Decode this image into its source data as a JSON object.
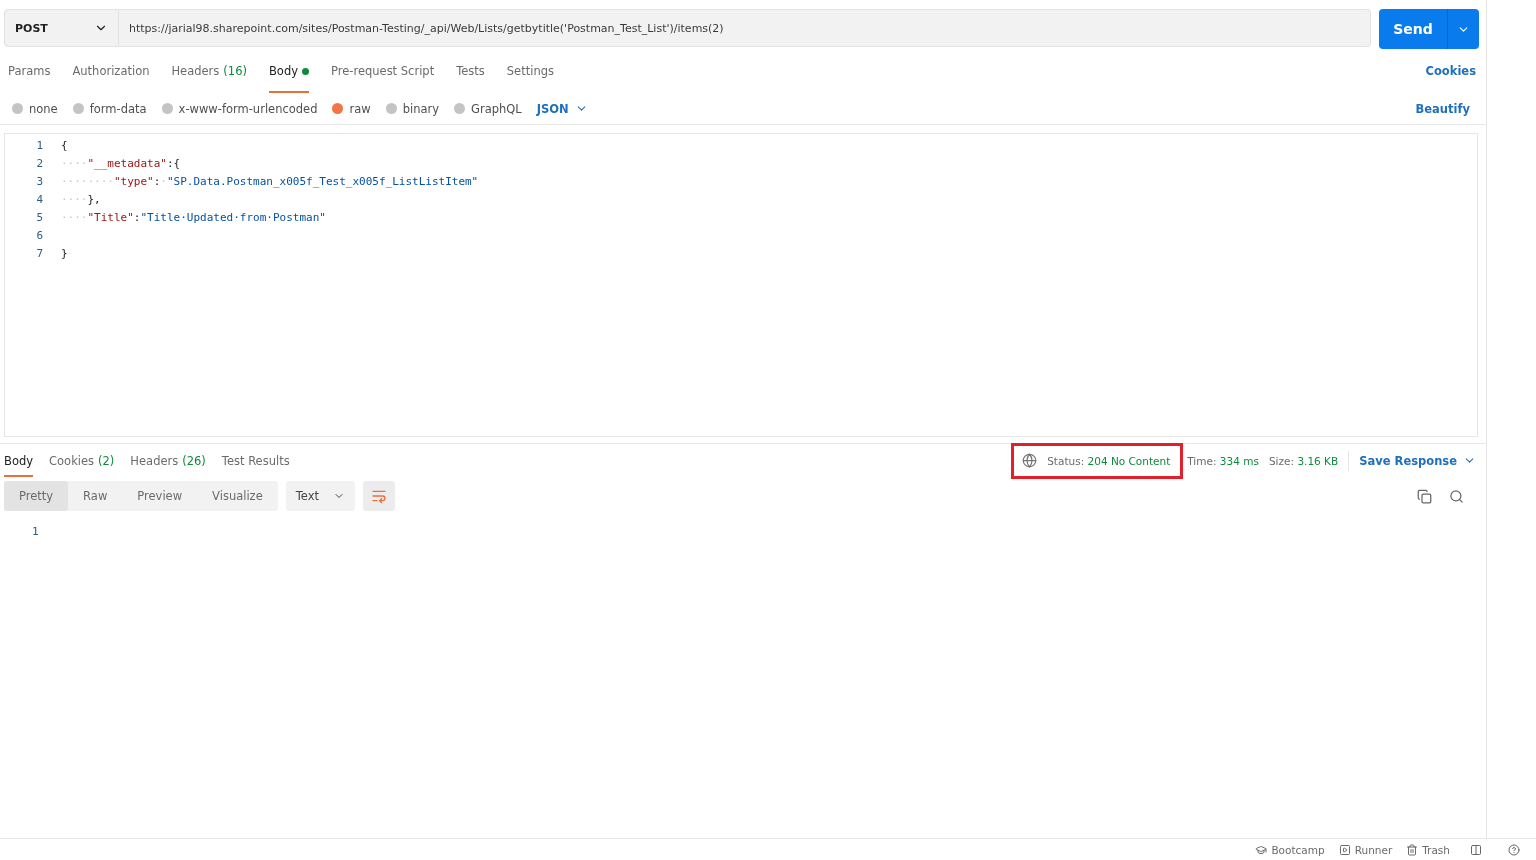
{
  "request": {
    "method": "POST",
    "url": "https://jarial98.sharepoint.com/sites/Postman-Testing/_api/Web/Lists/getbytitle('Postman_Test_List')/items(2)",
    "send": "Send"
  },
  "request_tabs": [
    {
      "label": "Params",
      "selected": false
    },
    {
      "label": "Authorization",
      "selected": false
    },
    {
      "label": "Headers",
      "count": "(16)",
      "selected": false
    },
    {
      "label": "Body",
      "dot": true,
      "selected": true
    },
    {
      "label": "Pre-request Script",
      "selected": false
    },
    {
      "label": "Tests",
      "selected": false
    },
    {
      "label": "Settings",
      "selected": false
    }
  ],
  "cookies_link": "Cookies",
  "body_types": [
    {
      "label": "none",
      "selected": false
    },
    {
      "label": "form-data",
      "selected": false
    },
    {
      "label": "x-www-form-urlencoded",
      "selected": false
    },
    {
      "label": "raw",
      "selected": true
    },
    {
      "label": "binary",
      "selected": false
    },
    {
      "label": "GraphQL",
      "selected": false
    }
  ],
  "language": "JSON",
  "beautify": "Beautify",
  "editor_lines": [
    {
      "number": "1",
      "tokens": [
        {
          "kind": "punct",
          "text": "{"
        }
      ]
    },
    {
      "number": "2",
      "tokens": [
        {
          "kind": "ws",
          "text": "····"
        },
        {
          "kind": "key",
          "text": "\"__metadata\""
        },
        {
          "kind": "punct",
          "text": ":{"
        }
      ]
    },
    {
      "number": "3",
      "tokens": [
        {
          "kind": "ws",
          "text": "········"
        },
        {
          "kind": "key",
          "text": "\"type\""
        },
        {
          "kind": "punct",
          "text": ":"
        },
        {
          "kind": "ws",
          "text": "·"
        },
        {
          "kind": "str",
          "text": "\"SP.Data.Postman_x005f_Test_x005f_ListListItem\""
        }
      ]
    },
    {
      "number": "4",
      "tokens": [
        {
          "kind": "ws",
          "text": "····"
        },
        {
          "kind": "punct",
          "text": "},"
        }
      ]
    },
    {
      "number": "5",
      "tokens": [
        {
          "kind": "ws",
          "text": "····"
        },
        {
          "kind": "key",
          "text": "\"Title\""
        },
        {
          "kind": "punct",
          "text": ":"
        },
        {
          "kind": "str",
          "text": "\"Title·Updated·from·Postman\""
        }
      ]
    },
    {
      "number": "6"
    },
    {
      "number": "7",
      "tokens": [
        {
          "kind": "punct",
          "text": "}"
        }
      ]
    }
  ],
  "response_tabs": [
    {
      "label": "Body",
      "selected": true
    },
    {
      "label": "Cookies",
      "count": "(2)",
      "selected": false
    },
    {
      "label": "Headers",
      "count": "(26)",
      "selected": false
    },
    {
      "label": "Test Results",
      "selected": false
    }
  ],
  "response_meta": [
    {
      "label": "Status:",
      "value": "204 No Content"
    },
    {
      "label": "Time:",
      "value": "334 ms"
    },
    {
      "label": "Size:",
      "value": "3.16 KB"
    }
  ],
  "save_response": "Save Response",
  "view_modes": [
    {
      "label": "Pretty",
      "selected": true
    },
    {
      "label": "Raw",
      "selected": false
    },
    {
      "label": "Preview",
      "selected": false
    },
    {
      "label": "Visualize",
      "selected": false
    }
  ],
  "format": "Text",
  "response_lines": [
    "1"
  ],
  "status_bar": [
    "Bootcamp",
    "Runner",
    "Trash"
  ]
}
